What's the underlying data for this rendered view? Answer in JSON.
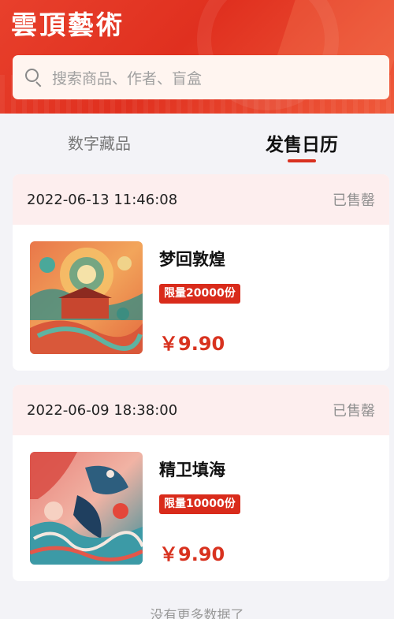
{
  "header": {
    "brand": "雲頂藝術",
    "search_placeholder": "搜索商品、作者、盲盒"
  },
  "tabs": [
    {
      "label": "数字藏品",
      "active": false
    },
    {
      "label": "发售日历",
      "active": true
    }
  ],
  "colors": {
    "accent": "#d9301f",
    "banner": "#e0301f",
    "card_head": "#fdeeee"
  },
  "items": [
    {
      "datetime": "2022-06-13 11:46:08",
      "status": "已售罄",
      "name": "梦回敦煌",
      "limit": "限量20000份",
      "price": "￥9.90"
    },
    {
      "datetime": "2022-06-09 18:38:00",
      "status": "已售罄",
      "name": "精卫填海",
      "limit": "限量10000份",
      "price": "￥9.90"
    }
  ],
  "footer": {
    "no_more": "没有更多数据了"
  }
}
